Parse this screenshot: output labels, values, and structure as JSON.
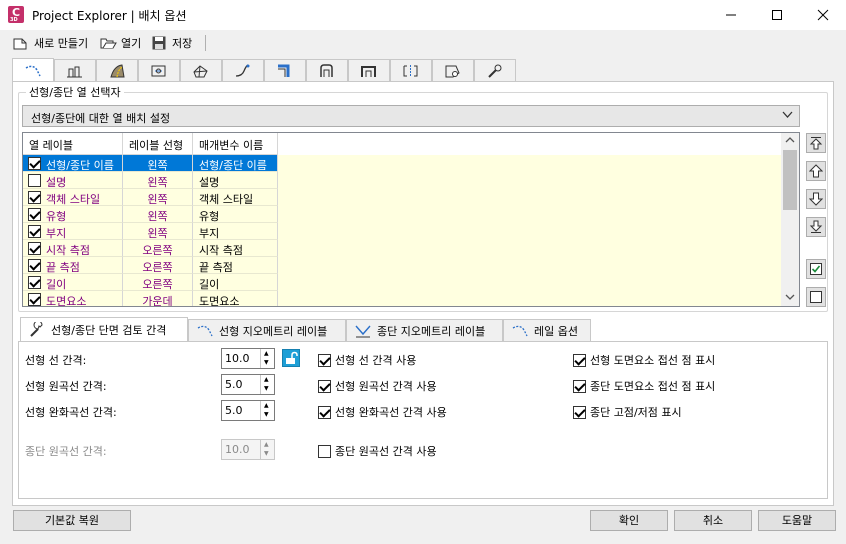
{
  "window": {
    "title": "Project Explorer | 배치 옵션",
    "app_icon_letter": "C",
    "app_icon_sub": "3D",
    "controls": [
      "minimize",
      "maximize",
      "close"
    ]
  },
  "toolbar": {
    "new_label": "새로 만들기",
    "open_label": "열기",
    "save_label": "저장"
  },
  "top_tabs": [
    {
      "icon": "alignment-icon",
      "active": true
    },
    {
      "icon": "profile-icon"
    },
    {
      "icon": "corridor-icon"
    },
    {
      "icon": "assembly-icon"
    },
    {
      "icon": "surface-icon"
    },
    {
      "icon": "featureline-icon"
    },
    {
      "icon": "pipe-network-icon"
    },
    {
      "icon": "structure-icon"
    },
    {
      "icon": "pressure-pipe-icon"
    },
    {
      "icon": "sample-line-icon"
    },
    {
      "icon": "parcel-icon"
    },
    {
      "icon": "tools-icon"
    }
  ],
  "group": {
    "legend": "선형/종단 열 선택자",
    "dropdown_value": "선형/종단에 대한 열 배치 설정"
  },
  "grid": {
    "columns": [
      "열 레이블",
      "레이블 선형",
      "매개변수 이름"
    ],
    "rows": [
      {
        "checked": true,
        "label": "선형/종단 이름",
        "align": "왼쪽",
        "param": "선형/종단 이름",
        "selected": true
      },
      {
        "checked": false,
        "label": "설명",
        "align": "왼쪽",
        "param": "설명"
      },
      {
        "checked": true,
        "label": "객체 스타일",
        "align": "왼쪽",
        "param": "객체 스타일"
      },
      {
        "checked": true,
        "label": "유형",
        "align": "왼쪽",
        "param": "유형"
      },
      {
        "checked": true,
        "label": "부지",
        "align": "왼쪽",
        "param": "부지"
      },
      {
        "checked": true,
        "label": "시작 측점",
        "align": "오른쪽",
        "param": "시작 측점"
      },
      {
        "checked": true,
        "label": "끝 측점",
        "align": "오른쪽",
        "param": "끝 측점"
      },
      {
        "checked": true,
        "label": "길이",
        "align": "오른쪽",
        "param": "길이"
      },
      {
        "checked": true,
        "label": "도면요소",
        "align": "가운데",
        "param": "도면요소"
      }
    ]
  },
  "side_buttons": [
    "move-top-icon",
    "move-up-icon",
    "move-down-icon",
    "move-bottom-icon",
    "check-all-icon",
    "uncheck-all-icon"
  ],
  "bottom_tabs": [
    {
      "label": "선형/종단 단면 검토 간격",
      "icon": "wrench-icon",
      "active": true
    },
    {
      "label": "선형 지오메트리 레이블",
      "icon": "alignment-geometry-icon"
    },
    {
      "label": "종단 지오메트리 레이블",
      "icon": "profile-geometry-icon"
    },
    {
      "label": "레일 옵션",
      "icon": "rail-icon"
    }
  ],
  "fields": [
    {
      "label": "선형 선 간격:",
      "value": "10.0",
      "disabled": false
    },
    {
      "label": "선형 원곡선 간격:",
      "value": "5.0",
      "disabled": false
    },
    {
      "label": "선형 완화곡선 간격:",
      "value": "5.0",
      "disabled": false
    },
    {
      "label": "종단 원곡선 간격:",
      "value": "10.0",
      "disabled": true
    }
  ],
  "checks_middle": [
    {
      "label": "선형 선 간격 사용",
      "checked": true
    },
    {
      "label": "선형 원곡선 간격 사용",
      "checked": true
    },
    {
      "label": "선형 완화곡선 간격 사용",
      "checked": true
    },
    {
      "label": "종단 원곡선 간격 사용",
      "checked": false
    }
  ],
  "checks_right": [
    {
      "label": "선형 도면요소 접선 점 표시",
      "checked": true
    },
    {
      "label": "종단 도면요소 접선 점 표시",
      "checked": true
    },
    {
      "label": "종단 고점/저점 표시",
      "checked": true
    }
  ],
  "footer": {
    "restore_label": "기본값 복원",
    "ok_label": "확인",
    "cancel_label": "취소",
    "help_label": "도움말"
  },
  "colors": {
    "row_background": "#ffffe0",
    "selection": "#0078d7",
    "label_purple": "#800080",
    "lock_blue": "#1e9fd6"
  }
}
